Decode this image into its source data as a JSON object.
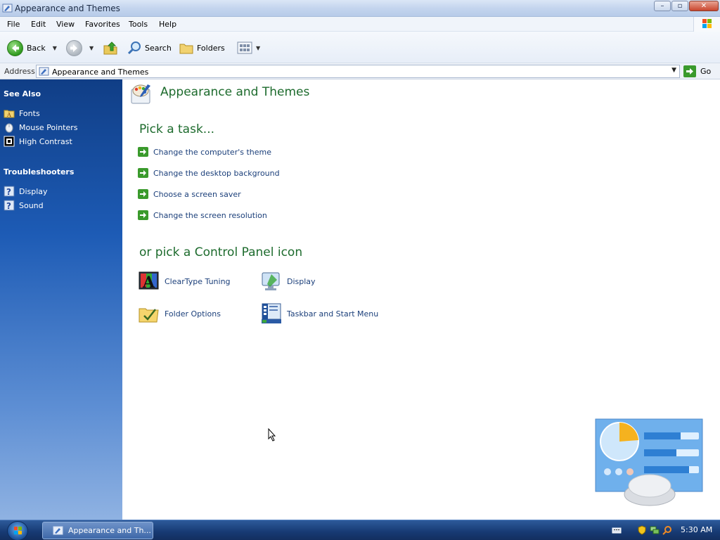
{
  "window": {
    "title": "Appearance and Themes",
    "buttons": {
      "minimize": "–",
      "maximize": "▫",
      "close": "✕"
    }
  },
  "menu": [
    "File",
    "Edit",
    "View",
    "Favorites",
    "Tools",
    "Help"
  ],
  "toolbar": {
    "back": "Back",
    "search": "Search",
    "folders": "Folders"
  },
  "address": {
    "label": "Address",
    "value": "Appearance and Themes",
    "go": "Go"
  },
  "sidebar": {
    "see_also": {
      "title": "See Also",
      "items": [
        "Fonts",
        "Mouse Pointers",
        "High Contrast"
      ]
    },
    "troubleshooters": {
      "title": "Troubleshooters",
      "items": [
        "Display",
        "Sound"
      ]
    }
  },
  "content": {
    "title": "Appearance and Themes",
    "pick_task": "Pick a task...",
    "tasks": [
      "Change the computer's theme",
      "Change the desktop background",
      "Choose a screen saver",
      "Change the screen resolution"
    ],
    "pick_icon": "or pick a Control Panel icon",
    "icons": [
      "ClearType Tuning",
      "Display",
      "Folder Options",
      "Taskbar and Start Menu"
    ]
  },
  "taskbar": {
    "window_button": "Appearance and Th...",
    "clock": "5:30 AM"
  },
  "colors": {
    "heading_green": "#1d6b2d",
    "link_blue": "#1b3f7a",
    "sidebar_top": "#103e86",
    "arrow_green": "#3a9a2c"
  }
}
